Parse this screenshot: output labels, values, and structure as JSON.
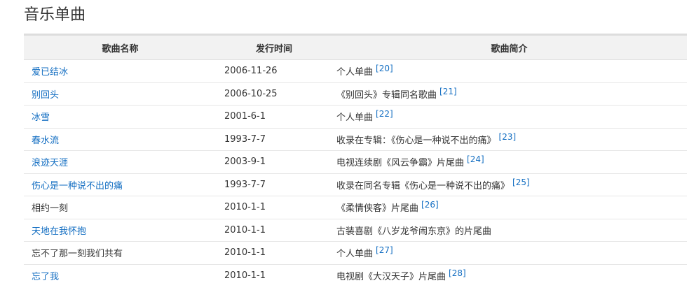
{
  "section": {
    "title": "音乐单曲"
  },
  "table": {
    "headers": [
      "歌曲名称",
      "发行时间",
      "歌曲简介"
    ],
    "rows": [
      {
        "name": "爱已结冰",
        "linked": true,
        "date": "2006-11-26",
        "desc": "个人单曲",
        "ref": "[20]"
      },
      {
        "name": "别回头",
        "linked": true,
        "date": "2006-10-25",
        "desc": "《别回头》专辑同名歌曲",
        "ref": "[21]"
      },
      {
        "name": "冰雪",
        "linked": true,
        "date": "2001-6-1",
        "desc": "个人单曲",
        "ref": "[22]"
      },
      {
        "name": "春水流",
        "linked": true,
        "date": "1993-7-7",
        "desc": "收录在专辑：《伤心是一种说不出的痛》",
        "ref": "[23]"
      },
      {
        "name": "浪迹天涯",
        "linked": true,
        "date": "2003-9-1",
        "desc": "电视连续剧《风云争霸》片尾曲",
        "ref": "[24]"
      },
      {
        "name": "伤心是一种说不出的痛",
        "linked": true,
        "date": "1993-7-7",
        "desc": "收录在同名专辑《伤心是一种说不出的痛》",
        "ref": "[25]"
      },
      {
        "name": "相约一刻",
        "linked": false,
        "date": "2010-1-1",
        "desc": "《柔情侠客》片尾曲",
        "ref": "[26]"
      },
      {
        "name": "天地在我怀抱",
        "linked": true,
        "date": "2010-1-1",
        "desc": "古装喜剧《八岁龙爷闹东京》的片尾曲",
        "ref": ""
      },
      {
        "name": "忘不了那一刻我们共有",
        "linked": false,
        "date": "2010-1-1",
        "desc": "个人单曲",
        "ref": "[27]"
      },
      {
        "name": "忘了我",
        "linked": true,
        "date": "2010-1-1",
        "desc": "电视剧《大汉天子》片尾曲",
        "ref": "[28]"
      }
    ]
  },
  "colors": {
    "link": "#136ec2",
    "text": "#333333",
    "header_bg": "#f2f2f2"
  }
}
